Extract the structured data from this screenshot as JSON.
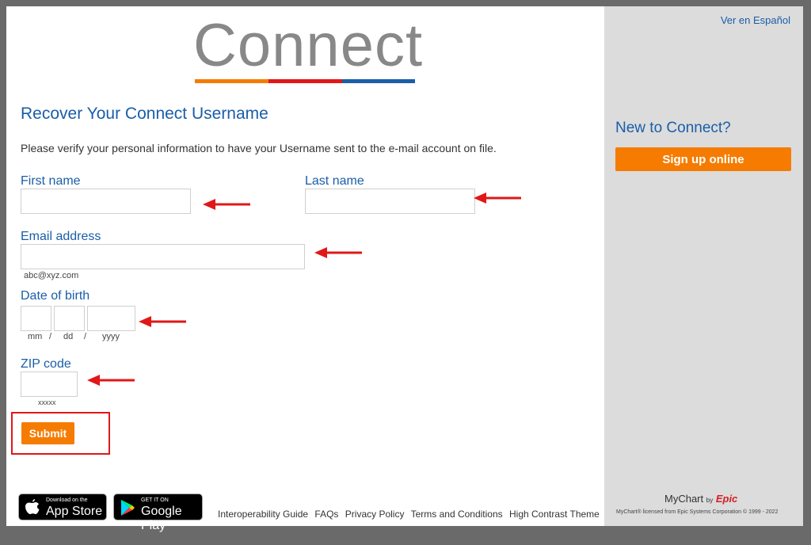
{
  "logo": {
    "text": "Connect",
    "bar_colors": [
      "#f57c00",
      "#e01818",
      "#1a5ea8"
    ]
  },
  "form": {
    "title": "Recover Your Connect Username",
    "intro": "Please verify your personal information to have your Username sent to the e-mail account on file.",
    "first_name_label": "First name",
    "last_name_label": "Last name",
    "email_label": "Email address",
    "email_hint": "abc@xyz.com",
    "dob_label": "Date of birth",
    "dob_mm_hint": "mm",
    "dob_dd_hint": "dd",
    "dob_yyyy_hint": "yyyy",
    "dob_separator": "/",
    "zip_label": "ZIP code",
    "zip_hint": "xxxxx",
    "submit_label": "Submit",
    "first_name_value": "",
    "last_name_value": "",
    "email_value": "",
    "dob_mm_value": "",
    "dob_dd_value": "",
    "dob_yyyy_value": "",
    "zip_value": ""
  },
  "annotations": {
    "arrow_color": "#e01818",
    "highlight_color": "#e01818"
  },
  "stores": {
    "apple_small": "Download on the",
    "apple_big": "App Store",
    "google_small": "GET IT ON",
    "google_big": "Google Play"
  },
  "footer": {
    "links": [
      "Interoperability Guide",
      "FAQs",
      "Privacy Policy",
      "Terms and Conditions",
      "High Contrast Theme"
    ]
  },
  "sidebar": {
    "language_link": "Ver en Español",
    "new_title": "New to Connect?",
    "signup_label": "Sign up online",
    "mychart_text": "MyChart",
    "by_text": "by",
    "epic_text": "Epic",
    "copyright": "MyChart® licensed from Epic Systems Corporation © 1999 - 2022"
  },
  "colors": {
    "accent_blue": "#1a5ea8",
    "button_orange": "#f57c00",
    "sidebar_bg": "#dcdcdc"
  }
}
